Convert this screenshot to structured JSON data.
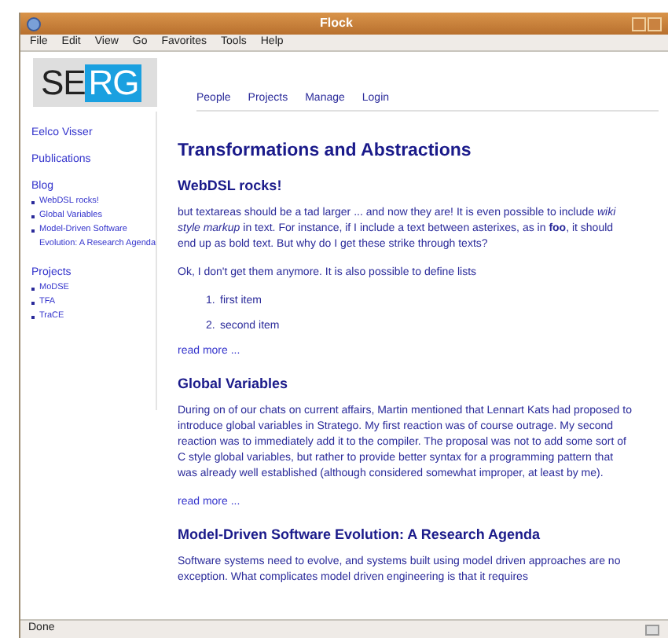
{
  "window": {
    "title": "Flock"
  },
  "menu": [
    "File",
    "Edit",
    "View",
    "Go",
    "Favorites",
    "Tools",
    "Help"
  ],
  "logo": {
    "left": "SE",
    "right": "RG"
  },
  "nav": [
    "People",
    "Projects",
    "Manage",
    "Login"
  ],
  "sidebar": {
    "top_links": [
      "Eelco Visser",
      "Publications"
    ],
    "sections": [
      {
        "title": "Blog",
        "items": [
          "WebDSL rocks!",
          "Global Variables",
          "Model-Driven Software Evolution: A Research Agenda"
        ]
      },
      {
        "title": "Projects",
        "items": [
          "MoDSE",
          "TFA",
          "TraCE"
        ]
      }
    ]
  },
  "page_title": "Transformations and Abstractions",
  "posts": [
    {
      "title": "WebDSL rocks!",
      "paragraphs": [
        "but textareas should be a tad larger ... and now they are! It is even possible to include *wiki style markup* in text. For instance, if I include a text between asterixes, as in **foo**, it should end up as bold text. But why do I get these strike through texts?",
        "Ok, I don't get them anymore. It is also possible to define lists"
      ],
      "list": [
        {
          "number": "1.",
          "text": "first item"
        },
        {
          "number": "2.",
          "text": "second item"
        }
      ],
      "read_more": "read more ..."
    },
    {
      "title": "Global Variables",
      "paragraphs": [
        "During on of our chats on current affairs, Martin mentioned that Lennart Kats had proposed to introduce global variables in Stratego. My first reaction was of course outrage. My second reaction was to immediately add it to the compiler. The proposal was not to add some sort of C style global variables, but rather to provide better syntax for a programming pattern that was already well established (although considered somewhat improper, at least by me)."
      ],
      "read_more": "read more ..."
    },
    {
      "title": "Model-Driven Software Evolution: A Research Agenda",
      "paragraphs": [
        "Software systems need to evolve, and systems built using model driven approaches are no exception. What complicates model driven engineering is that it requires"
      ]
    }
  ],
  "status_bar": {
    "text": "Done"
  }
}
